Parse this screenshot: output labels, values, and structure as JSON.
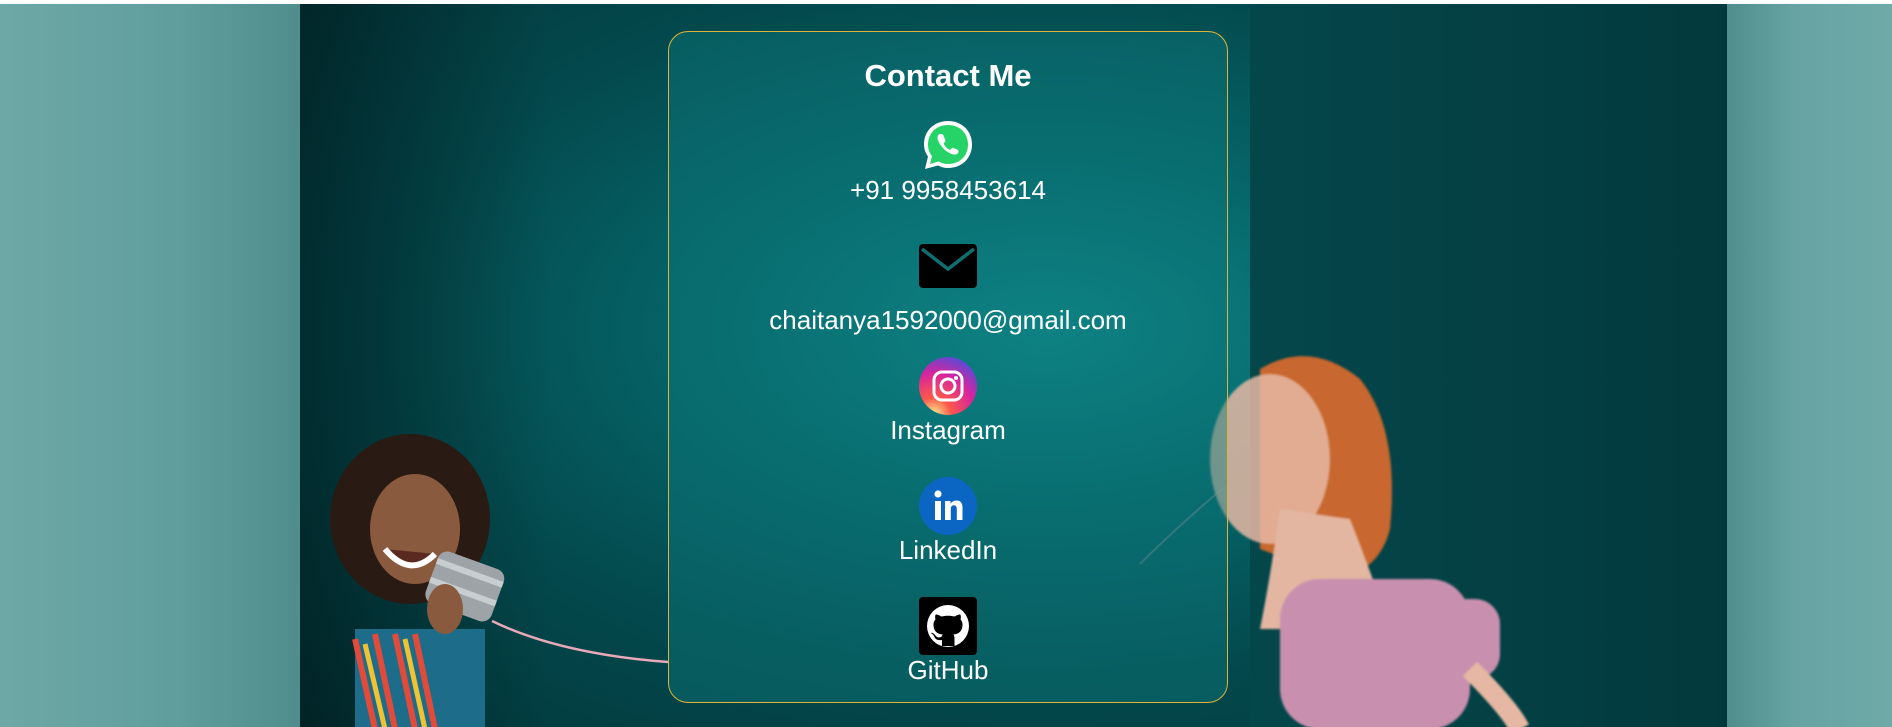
{
  "card": {
    "title": "Contact Me",
    "border_color": "#e0b43a"
  },
  "contacts": [
    {
      "icon": "whatsapp-icon",
      "label": "+91 9958453614",
      "color": "#25d366"
    },
    {
      "icon": "mail-icon",
      "label": "chaitanya1592000@gmail.com",
      "color": "#000000"
    },
    {
      "icon": "instagram-icon",
      "label": "Instagram",
      "color": "#d6249f"
    },
    {
      "icon": "linkedin-icon",
      "label": "LinkedIn",
      "color": "#0a66c2"
    },
    {
      "icon": "github-icon",
      "label": "GitHub",
      "color": "#000000"
    }
  ]
}
